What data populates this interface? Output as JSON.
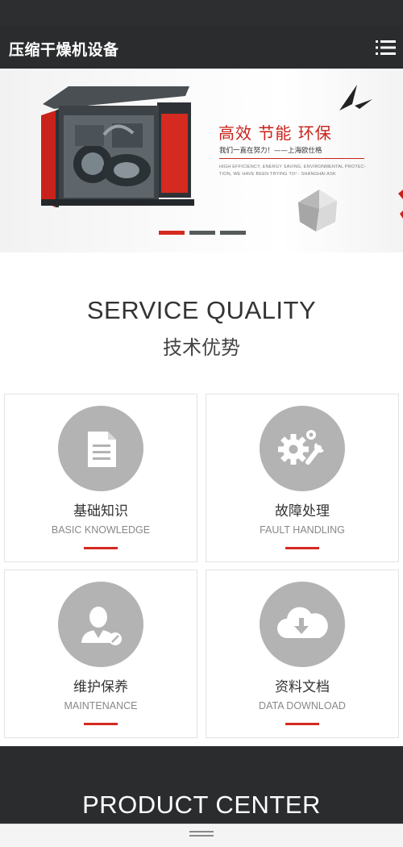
{
  "header": {
    "brand": "压缩干燥机设备",
    "menu_icon": "hamburger-menu-icon"
  },
  "banner": {
    "headline": "高效 节能 环保",
    "tagline": "我们一直在努力！——上海欧仕格",
    "english_line1": "HIGH EFFICIENCY, ENERGY SAVING, ENVIRONMENTAL PROTEC-",
    "english_line2": "TION, WE HAVE BEEN TRYING TO! - SHANGHAI ASK",
    "slides": 3,
    "active_slide": 1,
    "accent_color": "#d42a20"
  },
  "service": {
    "title": "SERVICE QUALITY",
    "subtitle": "技术优势",
    "cards": [
      {
        "cn": "基础知识",
        "en": "BASIC KNOWLEDGE",
        "icon": "document-icon"
      },
      {
        "cn": "故障处理",
        "en": "FAULT HANDLING",
        "icon": "gears-wrench-icon"
      },
      {
        "cn": "维护保养",
        "en": "MAINTENANCE",
        "icon": "technician-icon"
      },
      {
        "cn": "资料文档",
        "en": "DATA DOWNLOAD",
        "icon": "cloud-download-icon"
      }
    ]
  },
  "product": {
    "title": "PRODUCT CENTER"
  },
  "colors": {
    "header_bg": "#2b2c2e",
    "accent": "#d42a20",
    "icon_circle": "#b3b3b3"
  }
}
